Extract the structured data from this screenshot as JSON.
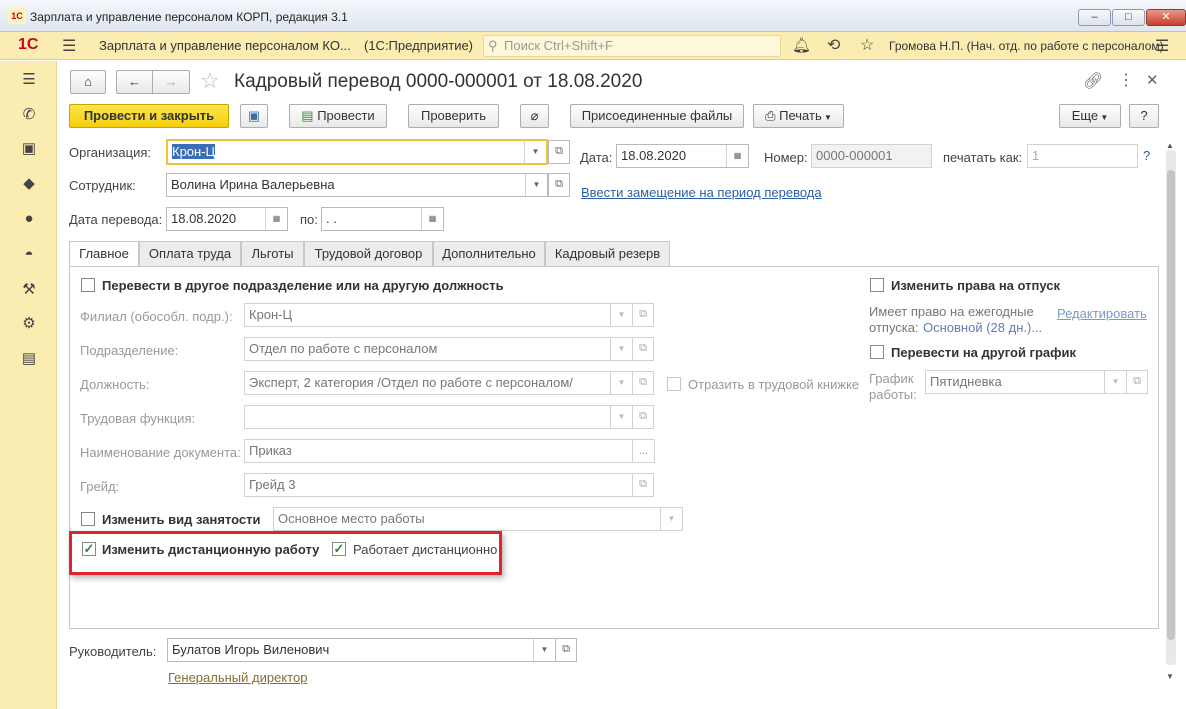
{
  "window": {
    "title": "Зарплата и управление персоналом КОРП, редакция 3.1",
    "logo": "1С",
    "btn_min": "–",
    "btn_max": "□",
    "btn_close": "✕"
  },
  "appbar": {
    "logo": "1С",
    "app_name": "Зарплата и управление персоналом КО...",
    "platform": "(1С:Предприятие)",
    "search_placeholder": "Поиск Ctrl+Shift+F",
    "user": "Громова Н.П. (Нач. отд. по работе с персоналом)"
  },
  "doc": {
    "title": "Кадровый перевод 0000-000001 от 18.08.2020",
    "buttons": {
      "post_close": "Провести и закрыть",
      "post": "Провести",
      "check": "Проверить",
      "files": "Присоединенные файлы",
      "print": "Печать",
      "more": "Еще",
      "help": "?"
    },
    "org_label": "Организация:",
    "org_value": "Крон-Ц",
    "date_label": "Дата:",
    "date_value": "18.08.2020",
    "number_label": "Номер:",
    "number_value": "0000-000001",
    "print_as_label": "печатать как:",
    "print_as_value": "1",
    "employee_label": "Сотрудник:",
    "employee_value": "Волина Ирина Валерьевна",
    "replacement_link": "Ввести замещение на период перевода",
    "transfer_date_label": "Дата перевода:",
    "transfer_date_value": "18.08.2020",
    "to_label": "по:",
    "to_value": " .  .",
    "tabs": [
      "Главное",
      "Оплата труда",
      "Льготы",
      "Трудовой договор",
      "Дополнительно",
      "Кадровый резерв"
    ],
    "main": {
      "transfer_check": "Перевести в другое подразделение или на другую должность",
      "branch_label": "Филиал (обособл. подр.):",
      "branch_value": "Крон-Ц",
      "dept_label": "Подразделение:",
      "dept_value": "Отдел по работе с персоналом",
      "position_label": "Должность:",
      "position_value": "Эксперт, 2 категория /Отдел по работе с персоналом/",
      "workbook_check": "Отразить в трудовой книжке",
      "function_label": "Трудовая функция:",
      "function_value": "",
      "docname_label": "Наименование документа:",
      "docname_value": "Приказ",
      "grade_label": "Грейд:",
      "grade_value": "Грейд 3",
      "employment_check": "Изменить вид занятости",
      "employment_value": "Основное место работы",
      "remote_check": "Изменить дистанционную работу",
      "remote_works": "Работает дистанционно",
      "vacation_check": "Изменить права на отпуск",
      "vacation_text1": "Имеет право на ежегодные",
      "vacation_text2": "отпуска:",
      "vacation_value": "Основной (28 дн.)...",
      "vacation_edit": "Редактировать",
      "schedule_check": "Перевести на другой график",
      "schedule_label1": "График",
      "schedule_label2": "работы:",
      "schedule_value": "Пятидневка"
    },
    "manager_label": "Руководитель:",
    "manager_value": "Булатов Игорь Виленович",
    "manager_position": "Генеральный директор"
  }
}
